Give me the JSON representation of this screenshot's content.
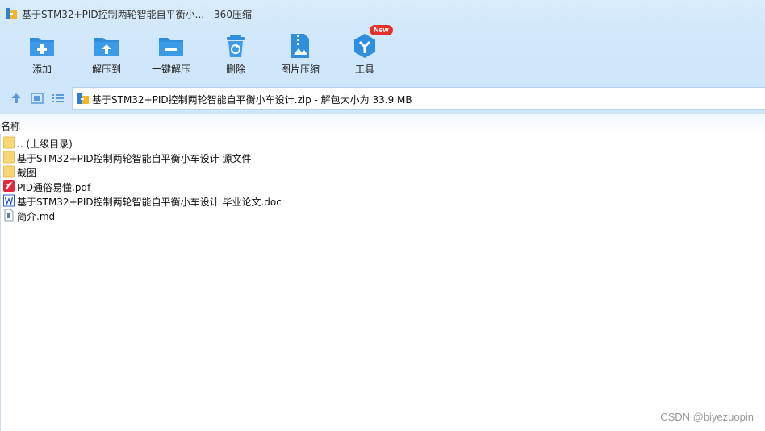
{
  "window": {
    "title": "基于STM32+PID控制两轮智能自平衡小... - 360压缩"
  },
  "toolbar": {
    "items": [
      {
        "label": "添加",
        "icon": "folder-add-icon"
      },
      {
        "label": "解压到",
        "icon": "folder-extract-icon"
      },
      {
        "label": "一键解压",
        "icon": "folder-oneclick-icon"
      },
      {
        "label": "删除",
        "icon": "trash-icon"
      },
      {
        "label": "图片压缩",
        "icon": "image-compress-icon"
      },
      {
        "label": "工具",
        "icon": "tools-icon",
        "badge": "New"
      }
    ]
  },
  "address": {
    "path": "基于STM32+PID控制两轮智能自平衡小车设计.zip - 解包大小为 33.9 MB"
  },
  "list": {
    "header_name": "名称",
    "items": [
      {
        "name": ".. (上级目录)",
        "type": "folder"
      },
      {
        "name": "基于STM32+PID控制两轮智能自平衡小车设计 源文件",
        "type": "folder"
      },
      {
        "name": "截图",
        "type": "folder"
      },
      {
        "name": "PID通俗易懂.pdf",
        "type": "pdf"
      },
      {
        "name": "基于STM32+PID控制两轮智能自平衡小车设计 毕业论文.doc",
        "type": "doc"
      },
      {
        "name": "简介.md",
        "type": "md"
      }
    ]
  },
  "watermark": "CSDN @biyezuopin",
  "colors": {
    "accent": "#2f8fdc",
    "folder": "#f9d776",
    "pdf": "#e2283d",
    "doc": "#2b5fc1"
  }
}
